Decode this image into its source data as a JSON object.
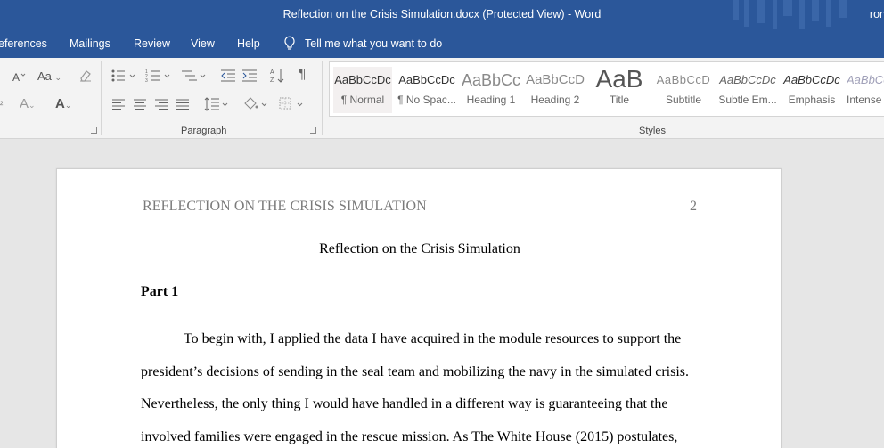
{
  "window": {
    "title": "Reflection on the Crisis Simulation.docx (Protected View)  -  Word",
    "user": "ron"
  },
  "tabs": [
    {
      "label": "eferences"
    },
    {
      "label": "Mailings"
    },
    {
      "label": "Review"
    },
    {
      "label": "View"
    },
    {
      "label": "Help"
    }
  ],
  "tell_me": {
    "placeholder": "Tell me what you want to do"
  },
  "font_group": {
    "case_label": "Aa",
    "grow_label": "A",
    "shrink_label": "A",
    "color_label": "A"
  },
  "paragraph_group": {
    "label": "Paragraph",
    "pilcrow": "¶"
  },
  "styles_group": {
    "label": "Styles",
    "items": [
      {
        "preview": "AaBbCcDc",
        "name": "¶ Normal"
      },
      {
        "preview": "AaBbCcDc",
        "name": "¶ No Spac..."
      },
      {
        "preview": "AaBbCc",
        "name": "Heading 1"
      },
      {
        "preview": "AaBbCcD",
        "name": "Heading 2"
      },
      {
        "preview": "AaB",
        "name": "Title"
      },
      {
        "preview": "AaBbCcD",
        "name": "Subtitle"
      },
      {
        "preview": "AaBbCcDc",
        "name": "Subtle Em..."
      },
      {
        "preview": "AaBbCcDc",
        "name": "Emphasis"
      },
      {
        "preview": "AaBbCc",
        "name": "Intense"
      }
    ]
  },
  "document": {
    "running_head": "REFLECTION ON THE CRISIS SIMULATION",
    "page_number": "2",
    "title": "Reflection on the Crisis Simulation",
    "section_heading": "Part 1",
    "paragraph_lines": [
      "To begin with, I applied the data I have acquired in the module resources to support the",
      "president’s decisions of sending in the seal team and mobilizing the navy in the simulated crisis.",
      "Nevertheless, the only thing I would have handled in a different way is guaranteeing that the",
      "involved families were engaged in the rescue mission. As The White House (2015) postulates,"
    ]
  },
  "colors": {
    "ribbon_blue": "#2b579a",
    "ribbon_body": "#f3f3f3",
    "canvas": "#e6e6e6"
  }
}
